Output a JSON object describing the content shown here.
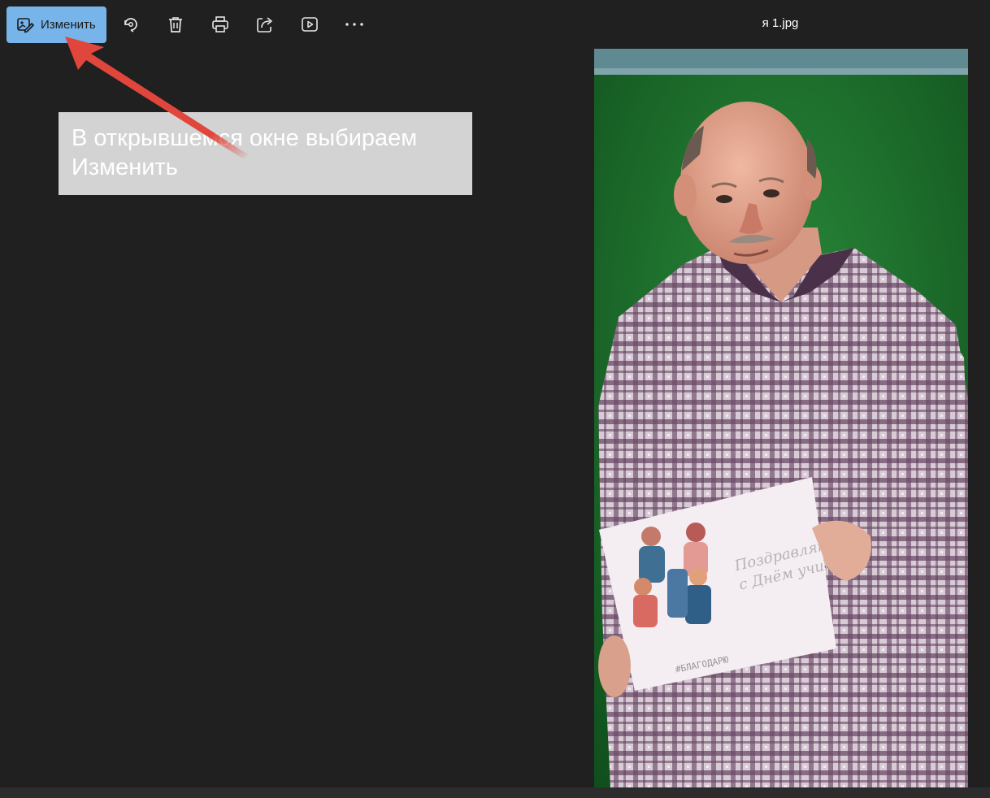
{
  "toolbar": {
    "edit_label": "Изменить",
    "icons": [
      "edit-image-icon",
      "rotate-icon",
      "delete-icon",
      "print-icon",
      "share-icon",
      "slideshow-icon",
      "more-icon"
    ]
  },
  "file": {
    "title": "я 1.jpg"
  },
  "annotation": {
    "text": "В открывшемся окне выбираем Изменить",
    "arrow_color": "#e0463c"
  },
  "photo": {
    "card_lines": [
      "Поздравляю",
      "с Днём учителя"
    ],
    "card_footer": "#БЛАГОДАРЮ"
  },
  "colors": {
    "background": "#202020",
    "accent": "#77b4ea",
    "callout_bg": "#d3d3d3"
  }
}
